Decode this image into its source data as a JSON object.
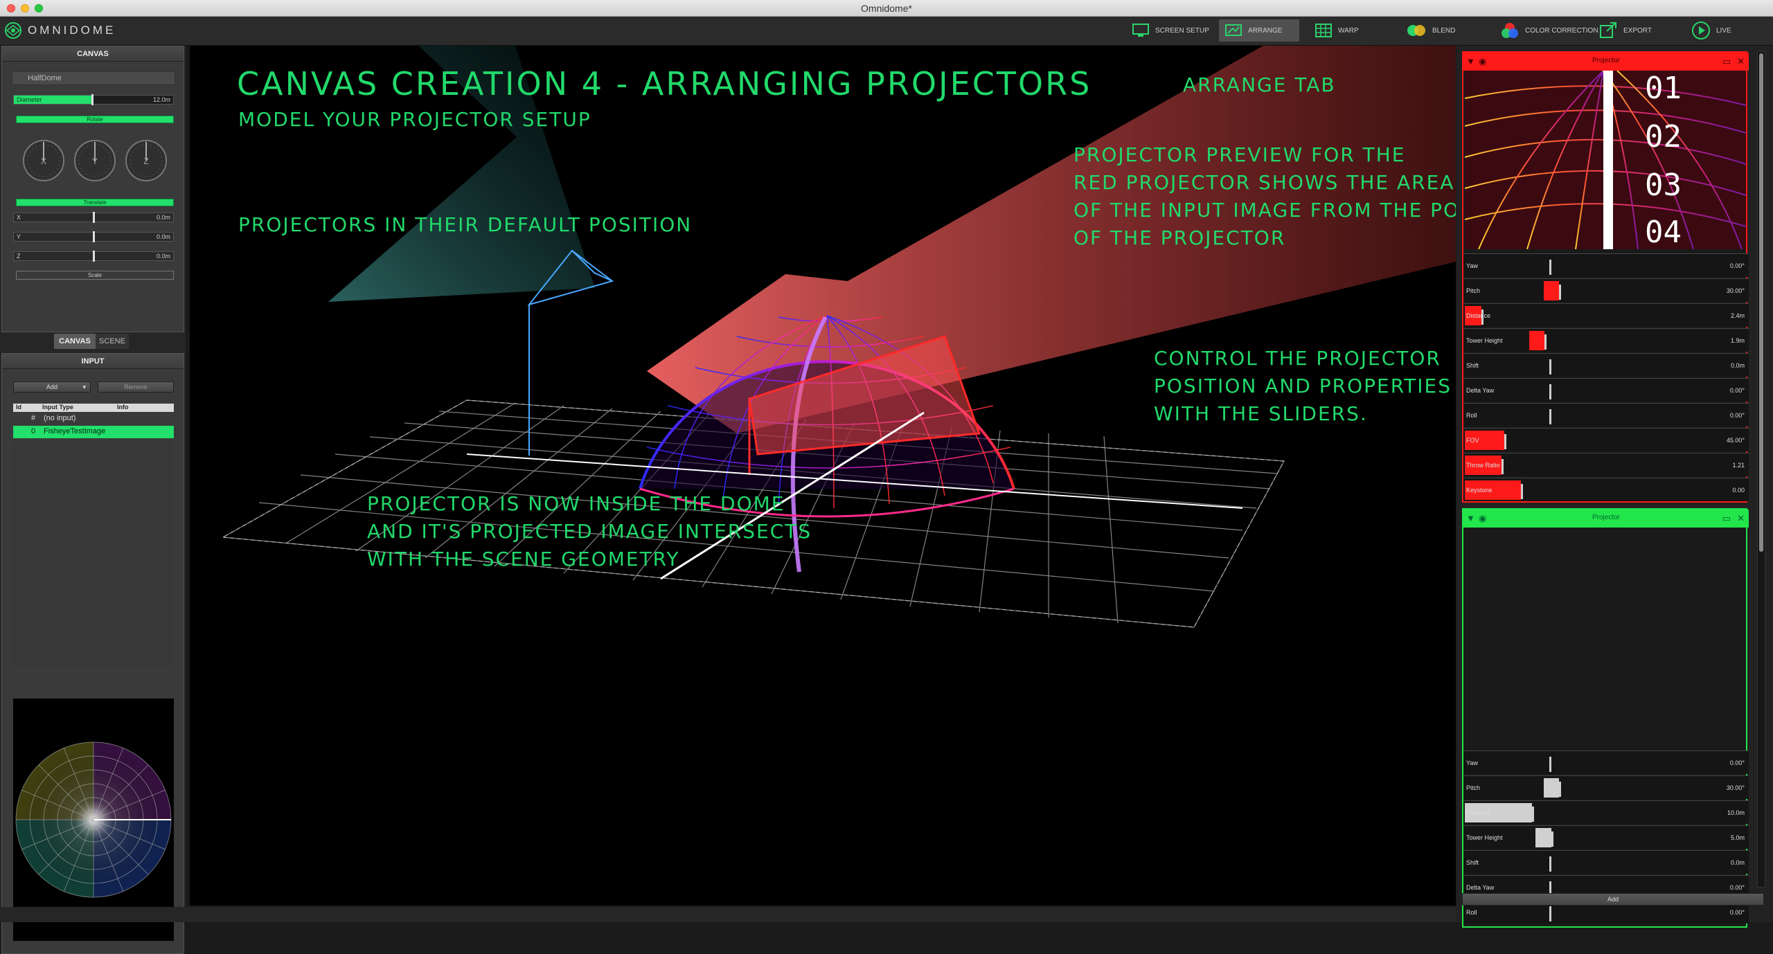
{
  "window": {
    "title": "Omnidome*"
  },
  "toolbar": {
    "logo": "OMNIDOME",
    "tabs": [
      {
        "label": "SCREEN SETUP",
        "icon": "monitor-icon"
      },
      {
        "label": "ARRANGE",
        "icon": "arrange-icon",
        "active": true
      },
      {
        "label": "WARP",
        "icon": "grid-icon"
      },
      {
        "label": "BLEND",
        "icon": "blend-icon"
      },
      {
        "label": "COLOR CORRECTION",
        "icon": "rgb-circles-icon"
      },
      {
        "label": "EXPORT",
        "icon": "export-icon"
      },
      {
        "label": "LIVE",
        "icon": "play-icon"
      }
    ]
  },
  "canvas": {
    "header": "CANVAS",
    "type": "HalfDome",
    "diameter": {
      "label": "Diameter",
      "value": "12.0m",
      "fraction": 0.3
    },
    "rotate_label": "Rotate",
    "dials": [
      {
        "label": "X"
      },
      {
        "label": "Y"
      },
      {
        "label": "Z"
      }
    ],
    "translate_label": "Translate",
    "translate": [
      {
        "label": "X",
        "value": "0.0m"
      },
      {
        "label": "Y",
        "value": "0.0m"
      },
      {
        "label": "Z",
        "value": "0.0m"
      }
    ],
    "scale_label": "Scale"
  },
  "subtabs": [
    {
      "label": "CANVAS",
      "active": true
    },
    {
      "label": "SCENE",
      "active": false
    }
  ],
  "input": {
    "header": "INPUT",
    "add_label": "Add",
    "remove_label": "Remove",
    "columns": [
      "Id",
      "Input Type",
      "Info"
    ],
    "rows": [
      {
        "id": "#",
        "type": "(no input)",
        "selected": false
      },
      {
        "id": "0",
        "type": "FisheyeTestImage",
        "selected": true
      }
    ]
  },
  "annotations": {
    "title": "CANVAS CREATION 4 - ARRANGING PROJECTORS",
    "subtitle": "MODEL YOUR PROJECTOR SETUP",
    "arrange_tab": "ARRANGE TAB",
    "preview": "PROJECTOR PREVIEW FOR THE\nRED PROJECTOR SHOWS THE AREA\nOF THE INPUT IMAGE FROM THE POV\nOF THE PROJECTOR",
    "default_pos": "PROJECTORS IN THEIR DEFAULT POSITION",
    "control": "CONTROL THE PROJECTOR\nPOSITION AND PROPERTIES\nWITH THE SLIDERS.",
    "inside": "PROJECTOR IS NOW INSIDE THE DOME\nAND IT'S PROJECTED IMAGE INTERSECTS\nWITH THE SCENE GEOMETRY"
  },
  "projectors": [
    {
      "name": "Projector",
      "color": "#ff1a1a",
      "preview_numbers": [
        "01",
        "02",
        "03",
        "04"
      ],
      "params": [
        {
          "label": "Yaw",
          "value": "0.00°",
          "fraction": 0.0
        },
        {
          "label": "Pitch",
          "value": "30.00°",
          "fraction": 0.35
        },
        {
          "label": "Distance",
          "value": "2.4m",
          "fraction": 0.06
        },
        {
          "label": "Tower Height",
          "value": "1.9m",
          "fraction": 0.22
        },
        {
          "label": "Shift",
          "value": "0.0m",
          "fraction": 0.0
        },
        {
          "label": "Delta Yaw",
          "value": "0.00°",
          "fraction": 0.0
        },
        {
          "label": "Roll",
          "value": "0.00°",
          "fraction": 0.0
        },
        {
          "label": "FOV",
          "value": "45.00°",
          "fraction": 0.14
        },
        {
          "label": "Throw Ratio",
          "value": "1.21",
          "fraction": 0.13
        },
        {
          "label": "Keystone",
          "value": "0.00",
          "fraction": 0.2
        }
      ]
    },
    {
      "name": "Projector",
      "color": "#22e64b",
      "params": [
        {
          "label": "Yaw",
          "value": "0.00°",
          "fraction": 0.0
        },
        {
          "label": "Pitch",
          "value": "30.00°",
          "fraction": 0.35
        },
        {
          "label": "Distance",
          "value": "10.0m",
          "fraction": 0.24
        },
        {
          "label": "Tower Height",
          "value": "5.0m",
          "fraction": 0.28
        },
        {
          "label": "Shift",
          "value": "0.0m",
          "fraction": 0.0
        },
        {
          "label": "Delta Yaw",
          "value": "0.00°",
          "fraction": 0.0
        },
        {
          "label": "Roll",
          "value": "0.00°",
          "fraction": 0.0
        }
      ]
    }
  ],
  "right_add_label": "Add"
}
